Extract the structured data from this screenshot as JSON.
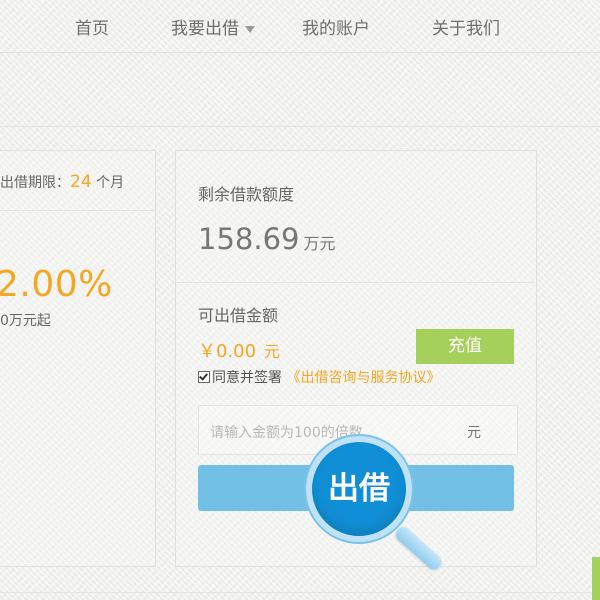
{
  "nav": {
    "items": [
      {
        "label": "首页"
      },
      {
        "label": "我要出借"
      },
      {
        "label": "我的账户"
      },
      {
        "label": "关于我们"
      }
    ]
  },
  "left_card": {
    "term_label": "出借期限：",
    "term_value": "24",
    "term_unit": "个月",
    "rate": "2.00%",
    "min_amount": "0万元起"
  },
  "right_card": {
    "remaining_label": "剩余借款额度",
    "remaining_amount": "158.69",
    "remaining_unit": "万元",
    "available_label": "可出借金额",
    "available_amount": "￥0.00",
    "available_unit": "元",
    "recharge_label": "充值",
    "agree_text": "同意并签署",
    "agreement_link": "《出借咨询与服务协议》",
    "amount_placeholder": "请输入金额为100的倍数",
    "amount_suffix": "元",
    "lend_label": "出借"
  },
  "colors": {
    "accent_orange": "#f5a623",
    "recharge_green": "#a6d05c",
    "lend_blue": "#73c0e6",
    "magnifier_blue": "#118fd6"
  }
}
